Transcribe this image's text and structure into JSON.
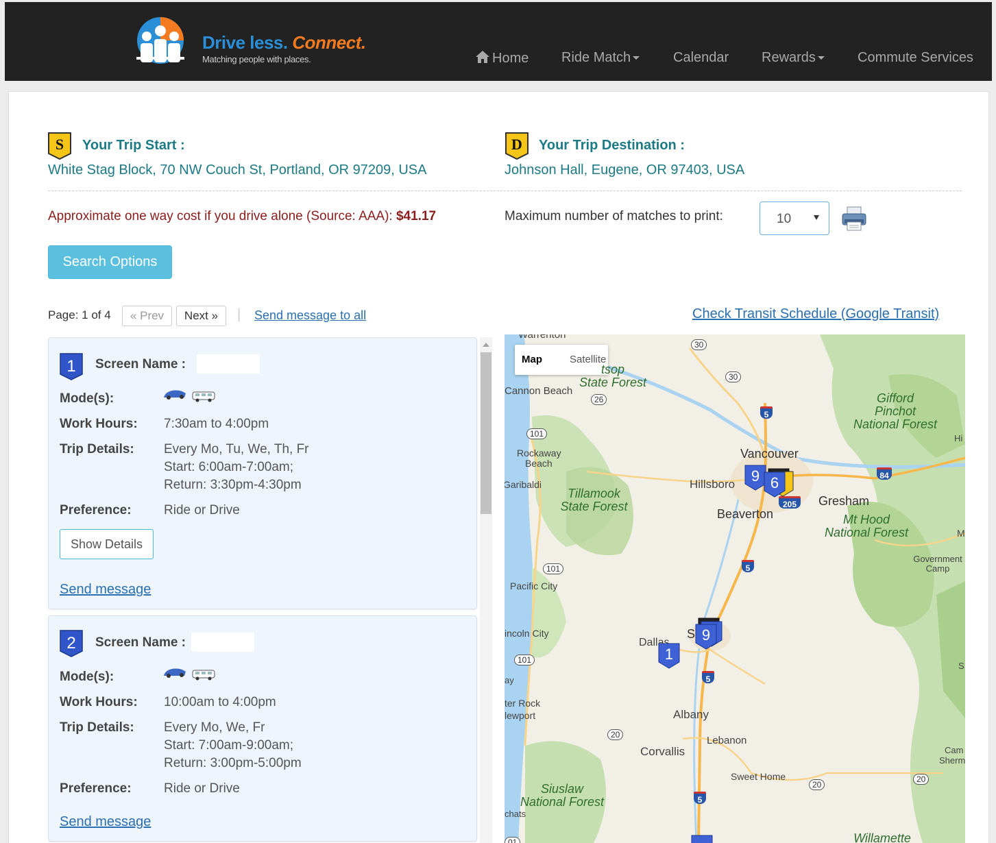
{
  "brand": {
    "title_part1": "Drive less.",
    "title_part2": "Connect.",
    "tagline": "Matching people with places."
  },
  "nav": {
    "home": "Home",
    "ride_match": "Ride Match",
    "calendar": "Calendar",
    "rewards": "Rewards",
    "commute_services": "Commute Services"
  },
  "trip": {
    "start_badge": "S",
    "start_label": "Your Trip Start :",
    "start_address": "White Stag Block, 70 NW Couch St, Portland, OR 97209, USA",
    "dest_badge": "D",
    "dest_label": "Your Trip Destination :",
    "dest_address": "Johnson Hall, Eugene, OR 97403, USA",
    "cost_text": "Approximate one way cost if you drive alone (Source: AAA): ",
    "cost_value": "$41.17",
    "max_matches_label": "Maximum number of matches to print:",
    "max_matches_value": "10"
  },
  "search_options_label": "Search Options",
  "pager": {
    "label": "Page: 1 of 4",
    "prev": "« Prev",
    "next": "Next »",
    "send_all": "Send message to all",
    "transit_link": "Check Transit Schedule (Google Transit)"
  },
  "labels": {
    "screen_name": "Screen Name :",
    "modes": "Mode(s):",
    "work_hours": "Work Hours:",
    "trip_details": "Trip Details:",
    "preference": "Preference:",
    "show_details": "Show Details",
    "send_message": "Send message"
  },
  "results": [
    {
      "number": "1",
      "work_hours": "7:30am to 4:00pm",
      "trip_days": "Every Mo, Tu, We, Th, Fr",
      "trip_start": "Start: 6:00am-7:00am;",
      "trip_return": "Return: 3:30pm-4:30pm",
      "preference": "Ride or Drive"
    },
    {
      "number": "2",
      "work_hours": "10:00am to 4:00pm",
      "trip_days": "Every Mo, We, Fr",
      "trip_start": "Start: 7:00am-9:00am;",
      "trip_return": "Return: 3:00pm-5:00pm",
      "preference": "Ride or Drive"
    }
  ],
  "map": {
    "toggle_map": "Map",
    "toggle_satellite": "Satellite",
    "places": {
      "warrenton": "Warrenton",
      "cannon_beach": "Cannon Beach",
      "rockaway": "Rockaway",
      "beach": "Beach",
      "garibaldi": "Garibaldi",
      "vancouver": "Vancouver",
      "hillsboro": "Hillsboro",
      "beaverton": "Beaverton",
      "gresham": "Gresham",
      "pacific_city": "Pacific City",
      "lincoln_city": "incoln City",
      "dallas": "Dallas",
      "s": "S",
      "ay": "ay",
      "ter_rock": "ter Rock",
      "newport": "lewport",
      "albany": "Albany",
      "corvallis": "Corvallis",
      "lebanon": "Lebanon",
      "sweet_home": "Sweet Home",
      "chats": "chats",
      "government_camp": "Government Camp",
      "cam": "Cam",
      "sherm": "Sherm",
      "h": "Hi",
      "m": "M",
      "s2": "S"
    },
    "forests": {
      "clatsop_1": "tsop",
      "clatsop_2": "State Forest",
      "gifford_1": "Gifford",
      "gifford_2": "Pinchot",
      "gifford_3": "National Forest",
      "tillamook_1": "Tillamook",
      "tillamook_2": "State Forest",
      "mthood_1": "Mt Hood",
      "mthood_2": "National Forest",
      "siuslaw_1": "Siuslaw",
      "siuslaw_2": "National Forest",
      "willamette": "Willamette"
    },
    "shields": {
      "us30a": "30",
      "us30b": "30",
      "us26": "26",
      "us101a": "101",
      "us101b": "101",
      "us101c": "101",
      "us20a": "20",
      "us20b": "20",
      "us20c": "20",
      "us101d": "01",
      "i205": "205"
    },
    "interstates": {
      "i5a": "5",
      "i5b": "5",
      "i5c": "5",
      "i5d": "5",
      "i84": "84"
    },
    "markers": {
      "portland_a": "9",
      "portland_b": "6",
      "salem": "9",
      "dallas": "1"
    }
  }
}
